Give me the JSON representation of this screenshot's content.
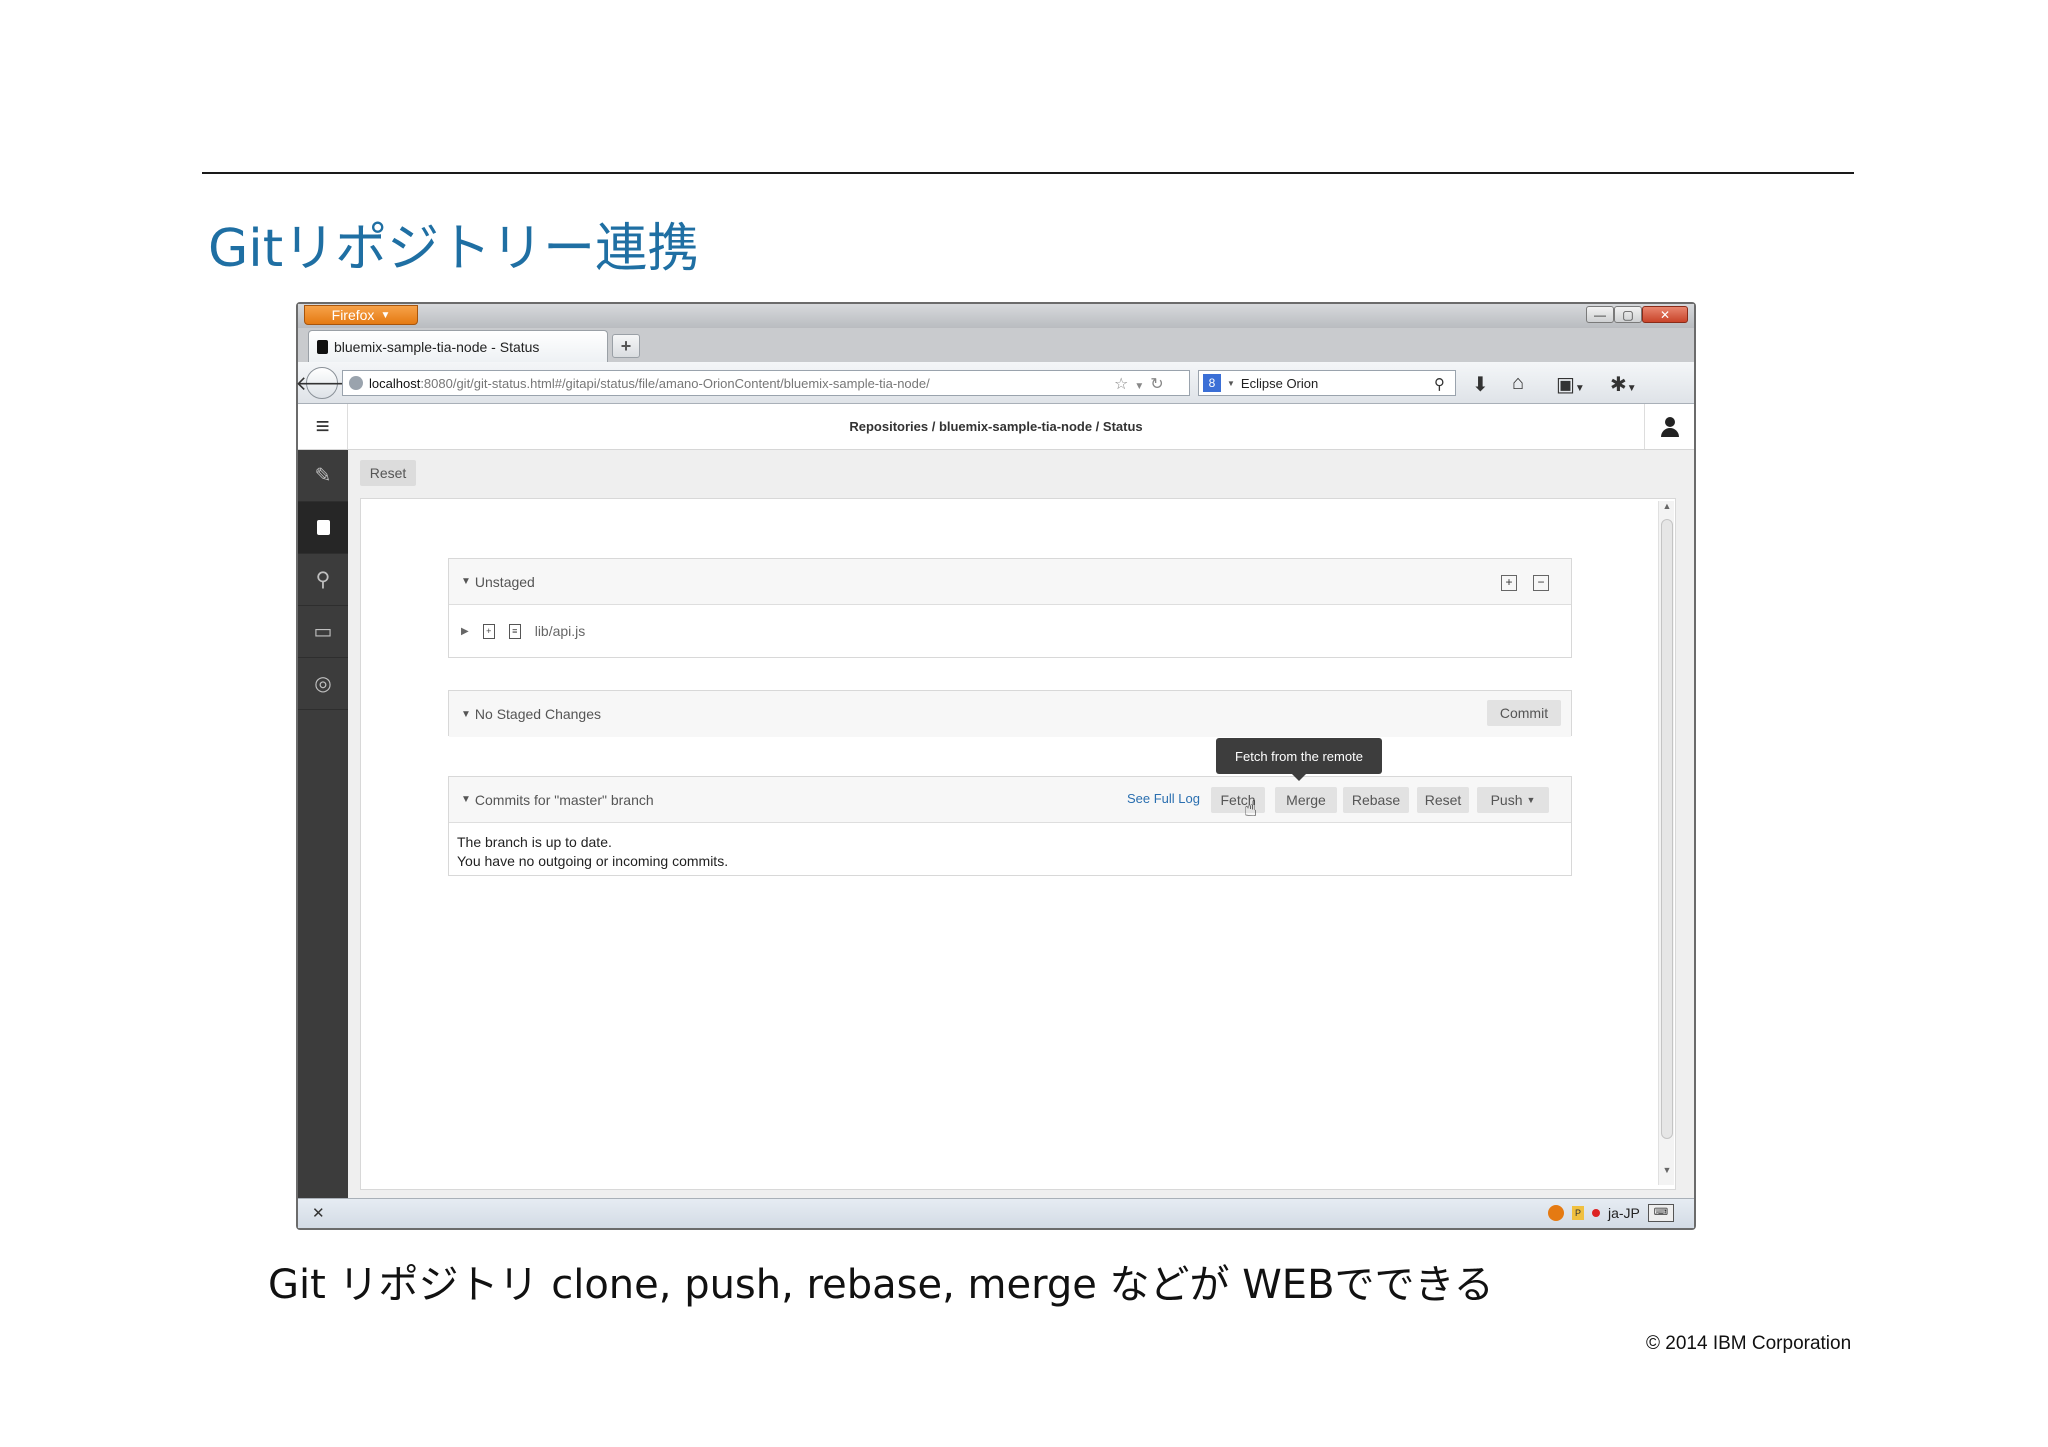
{
  "slide": {
    "title": "Gitリポジトリー連携",
    "caption": "Git リポジトリ clone, push, rebase, merge などが WEBでできる",
    "copyright": "© 2014 IBM Corporation"
  },
  "browser": {
    "app_button": "Firefox",
    "tab_title": "bluemix-sample-tia-node - Status",
    "url_host": "localhost",
    "url_rest": ":8080/git/git-status.html#/gitapi/status/file/amano-OrionContent/bluemix-sample-tia-node/",
    "search_engine": "Eclipse Orion",
    "status_locale": "ja-JP"
  },
  "app": {
    "breadcrumb": "Repositories / bluemix-sample-tia-node / Status",
    "toolbar_reset": "Reset",
    "sections": {
      "unstaged": {
        "title": "Unstaged",
        "file": "lib/api.js"
      },
      "staged": {
        "title": "No Staged Changes",
        "commit_label": "Commit"
      },
      "commits": {
        "title": "Commits for \"master\" branch",
        "see_full_log": "See Full Log",
        "buttons": {
          "fetch": "Fetch",
          "merge": "Merge",
          "rebase": "Rebase",
          "reset": "Reset",
          "push": "Push"
        },
        "status_line1": "The branch is up to date.",
        "status_line2": "You have no outgoing or incoming commits."
      }
    },
    "tooltip": "Fetch from the remote"
  },
  "colors": {
    "title_blue": "#1f6fa3",
    "sidebar_dark": "#3c3c3c",
    "firefox_orange": "#e57a12"
  }
}
